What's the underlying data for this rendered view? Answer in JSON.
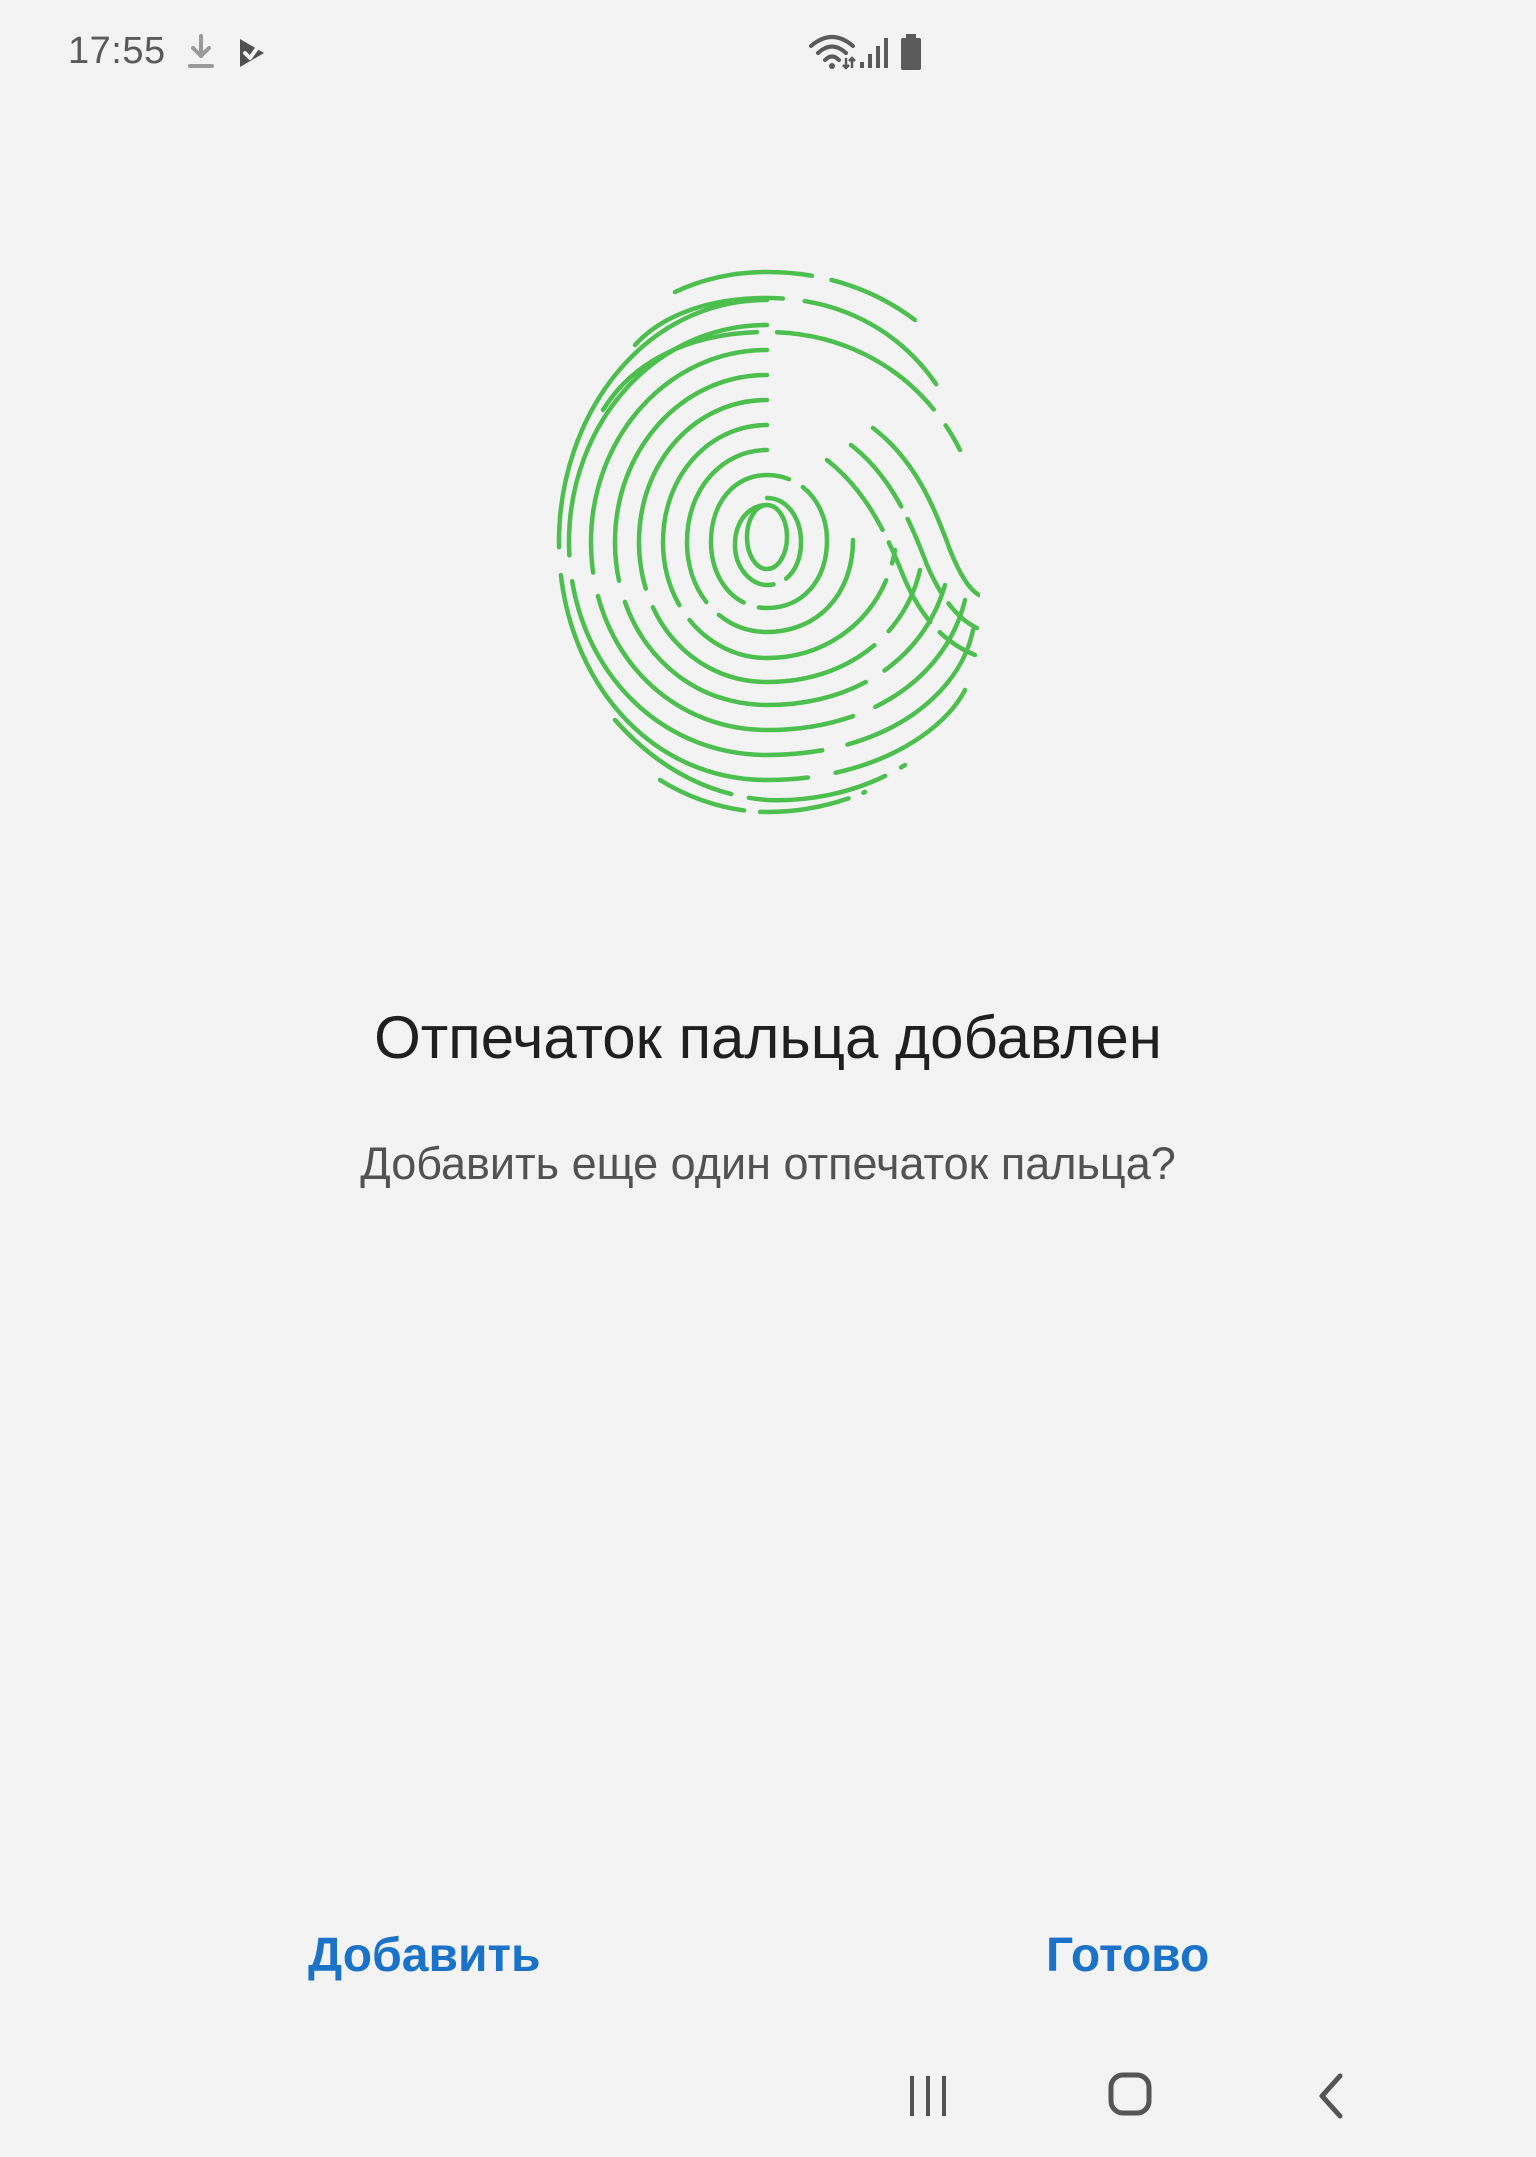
{
  "status_bar": {
    "time": "17:55",
    "icons": [
      "download-icon",
      "play-store-icon",
      "wifi-icon",
      "signal-icon",
      "battery-icon"
    ]
  },
  "colors": {
    "background": "#f3f3f3",
    "fingerprint_green": "#4cbf4f",
    "accent_blue": "#1a73c8",
    "title_text": "#1f1f1f",
    "subtitle_text": "#525252"
  },
  "main": {
    "illustration": "fingerprint-icon",
    "title": "Отпечаток пальца добавлен",
    "subtitle": "Добавить еще один отпечаток пальца?"
  },
  "actions": {
    "add_label": "Добавить",
    "done_label": "Готово"
  },
  "navigation": {
    "items": [
      "recent-apps-icon",
      "home-icon",
      "back-icon"
    ]
  }
}
